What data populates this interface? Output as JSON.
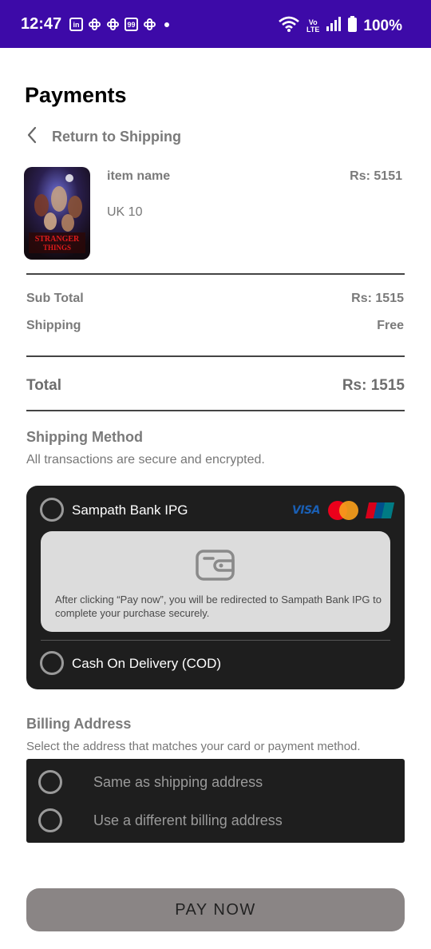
{
  "status_bar": {
    "time": "12:47",
    "left_icons": [
      "linkedin-icon",
      "slack-icon",
      "slack-icon",
      "99-icon",
      "slack-icon",
      "dot"
    ],
    "linkedin_text": "in",
    "ninety_nine_text": "99",
    "volte_top": "Vo",
    "volte_bottom": "LTE",
    "battery_text": "100%"
  },
  "header": {
    "title": "Payments",
    "back_label": "Return to Shipping"
  },
  "item": {
    "image_icon": "poster-thumbnail",
    "poster_title": "STRANGER THINGS",
    "name": "item name",
    "price": "Rs: 5151",
    "size": "UK 10"
  },
  "summary": {
    "subtotal_label": "Sub Total",
    "subtotal_value": "Rs: 1515",
    "shipping_label": "Shipping",
    "shipping_value": "Free",
    "total_label": "Total",
    "total_value": "Rs: 1515"
  },
  "shipping_method": {
    "title": "Shipping Method",
    "subtitle": "All transactions are secure and encrypted.",
    "options": [
      {
        "label": "Sampath Bank IPG"
      },
      {
        "label": "Cash On Delivery  (COD)"
      }
    ],
    "logos": {
      "visa": "VISA",
      "unionpay": "UnionPay"
    },
    "redirect_text": "After clicking “Pay now”, you will be redirected to Sampath Bank IPG to complete your purchase securely."
  },
  "billing": {
    "title": "Billing Address",
    "subtitle": "Select the address that matches your card or payment method.",
    "options": [
      {
        "label": "Same as shipping address"
      },
      {
        "label": "Use a different billing address"
      }
    ]
  },
  "pay_button": {
    "label": "PAY NOW"
  },
  "colors": {
    "status_bar": "#3d0aa8",
    "card_bg": "#1e1e1e",
    "button_bg": "#8a8585",
    "muted_text": "#7a7a7a"
  }
}
